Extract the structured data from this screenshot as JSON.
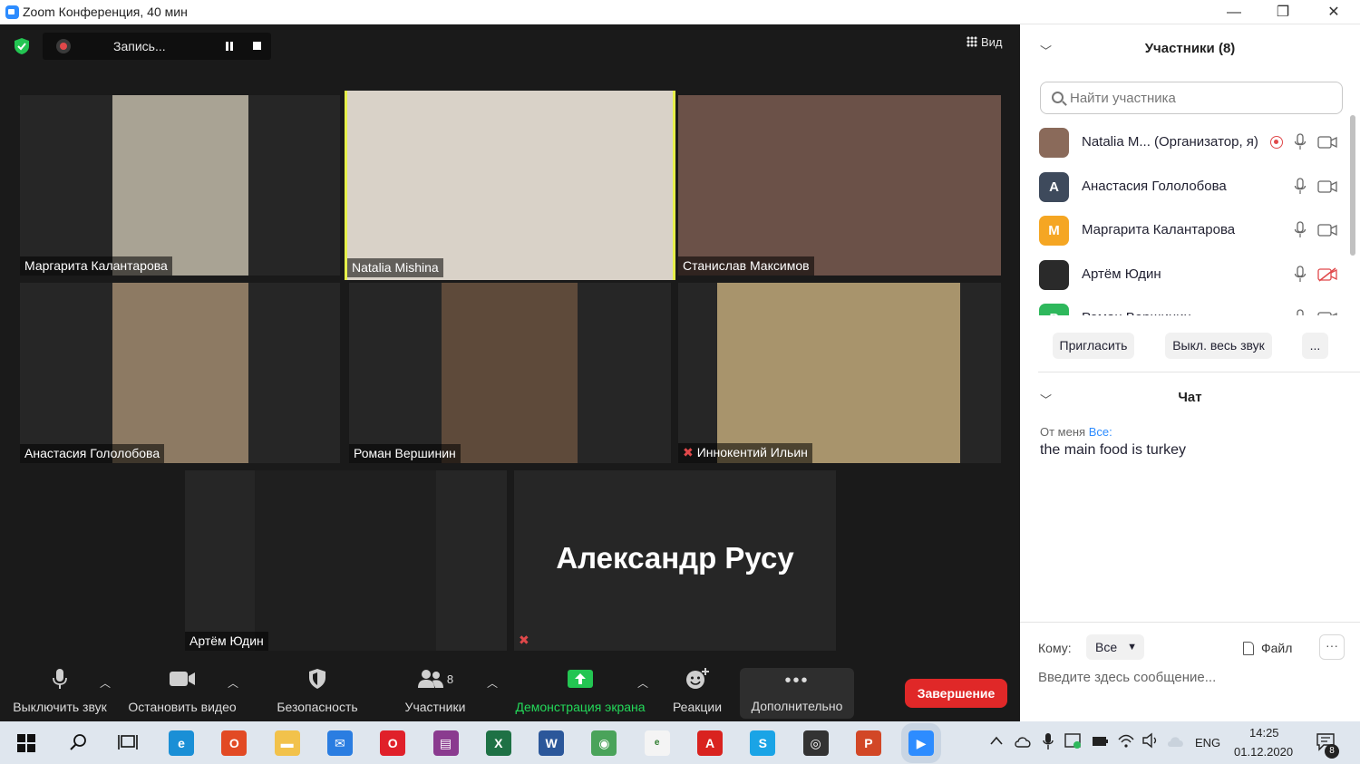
{
  "window": {
    "title": "Zoom Конференция, 40 мин",
    "minimize": "—",
    "maximize": "❐",
    "close": "✕"
  },
  "meeting": {
    "recording_label": "Запись...",
    "view_label": "Вид",
    "participants": [
      {
        "name": "Маргарита Калантарова",
        "bg": "#a9a394",
        "muted": false,
        "active": false
      },
      {
        "name": "Natalia Mishina",
        "bg": "#d9d2c8",
        "muted": false,
        "active": true
      },
      {
        "name": "Станислав Максимов",
        "bg": "#6b5148",
        "muted": false,
        "active": false
      },
      {
        "name": "Анастасия Гололобова",
        "bg": "#8d7a63",
        "muted": false,
        "active": false
      },
      {
        "name": "Роман Вершинин",
        "bg": "#5e4a3a",
        "muted": false,
        "active": false
      },
      {
        "name": "Иннокентий Ильин",
        "bg": "#a8946c",
        "muted": true,
        "active": false
      },
      {
        "name": "Артём Юдин",
        "bg": "#1f1f1f",
        "muted": false,
        "active": false
      },
      {
        "name": "Александр Русу",
        "bg": "#262626",
        "muted": true,
        "active": false
      }
    ]
  },
  "toolbar": {
    "mute": "Выключить звук",
    "video": "Остановить видео",
    "security": "Безопасность",
    "participants": "Участники",
    "participants_count": "8",
    "share": "Демонстрация экрана",
    "reactions": "Реакции",
    "more": "Дополнительно",
    "end": "Завершение"
  },
  "sidebar": {
    "participants_header": "Участники (8)",
    "search_placeholder": "Найти участника",
    "list": [
      {
        "name": "Natalia M... (Организатор, я)",
        "avatar": "",
        "color": "#8a6a5a",
        "recording": true,
        "cam_off": false
      },
      {
        "name": "Анастасия Гололобова",
        "avatar": "А",
        "color": "#3e4a5c",
        "recording": false,
        "cam_off": false
      },
      {
        "name": "Маргарита Калантарова",
        "avatar": "М",
        "color": "#f5a623",
        "recording": false,
        "cam_off": false
      },
      {
        "name": "Артём Юдин",
        "avatar": "",
        "color": "#2a2a2a",
        "recording": false,
        "cam_off": true
      },
      {
        "name": "Роман Вершинин",
        "avatar": "Р",
        "color": "#2eb85c",
        "recording": false,
        "cam_off": false
      }
    ],
    "invite": "Пригласить",
    "mute_all": "Выкл. весь звук",
    "more": "...",
    "chat_header": "Чат",
    "chat_from": "От меня",
    "chat_to": "Все:",
    "chat_message": "the main food is turkey",
    "to_label": "Кому:",
    "to_value": "Все",
    "file_label": "Файл",
    "more_chat": "···",
    "input_placeholder": "Введите здесь сообщение..."
  },
  "taskbar": {
    "lang": "ENG",
    "time": "14:25",
    "date": "01.12.2020",
    "notifications": "8",
    "apps": [
      {
        "name": "edge",
        "color": "#1a8fd6",
        "glyph": "e"
      },
      {
        "name": "office",
        "color": "#e24a24",
        "glyph": "O"
      },
      {
        "name": "explorer",
        "color": "#f2c24b",
        "glyph": "▬"
      },
      {
        "name": "mail",
        "color": "#2a7de1",
        "glyph": "✉"
      },
      {
        "name": "opera",
        "color": "#e0202a",
        "glyph": "O"
      },
      {
        "name": "winrar",
        "color": "#8a3b8f",
        "glyph": "▤"
      },
      {
        "name": "excel",
        "color": "#1e7145",
        "glyph": "X"
      },
      {
        "name": "word",
        "color": "#2b579a",
        "glyph": "W"
      },
      {
        "name": "chrome",
        "color": "#4aa35a",
        "glyph": "◉"
      },
      {
        "name": "epanel",
        "color": "#f4f4f4",
        "glyph": "e"
      },
      {
        "name": "acrobat",
        "color": "#d9231f",
        "glyph": "A"
      },
      {
        "name": "skype",
        "color": "#1aa4e6",
        "glyph": "S"
      },
      {
        "name": "media",
        "color": "#333333",
        "glyph": "◎"
      },
      {
        "name": "powerpoint",
        "color": "#d24726",
        "glyph": "P"
      },
      {
        "name": "zoom",
        "color": "#2d8cff",
        "glyph": "▶"
      }
    ]
  }
}
